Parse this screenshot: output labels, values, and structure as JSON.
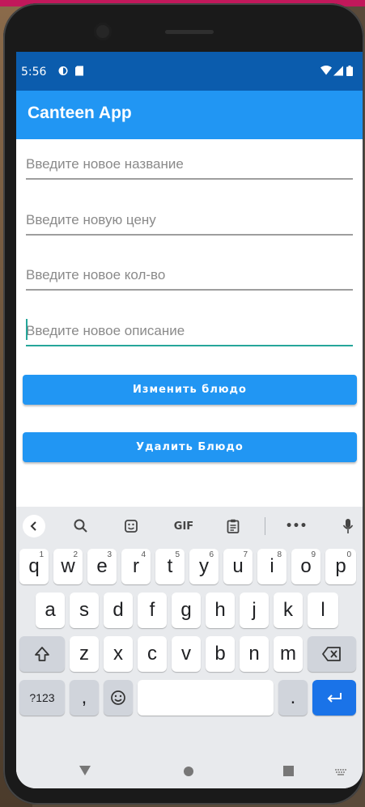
{
  "status": {
    "time": "5:56"
  },
  "app": {
    "title": "Canteen App"
  },
  "form": {
    "name_placeholder": "Введите новое название",
    "price_placeholder": "Введите новую цену",
    "qty_placeholder": "Введите новое кол-во",
    "desc_placeholder": "Введите новое описание",
    "edit_button": "Изменить блюдо",
    "delete_button": "Удалить Блюдо"
  },
  "keyboard": {
    "gif_label": "GIF",
    "row1": [
      {
        "k": "q",
        "n": "1"
      },
      {
        "k": "w",
        "n": "2"
      },
      {
        "k": "e",
        "n": "3"
      },
      {
        "k": "r",
        "n": "4"
      },
      {
        "k": "t",
        "n": "5"
      },
      {
        "k": "y",
        "n": "6"
      },
      {
        "k": "u",
        "n": "7"
      },
      {
        "k": "i",
        "n": "8"
      },
      {
        "k": "o",
        "n": "9"
      },
      {
        "k": "p",
        "n": "0"
      }
    ],
    "row2": [
      "a",
      "s",
      "d",
      "f",
      "g",
      "h",
      "j",
      "k",
      "l"
    ],
    "row3": [
      "z",
      "x",
      "c",
      "v",
      "b",
      "n",
      "m"
    ],
    "symbols_label": "?123",
    "comma": ",",
    "period": "."
  },
  "colors": {
    "status_bar": "#0b5cad",
    "app_bar": "#2196f3",
    "button": "#2196f3",
    "focus": "#26a69a",
    "enter_key": "#1a73e8"
  }
}
